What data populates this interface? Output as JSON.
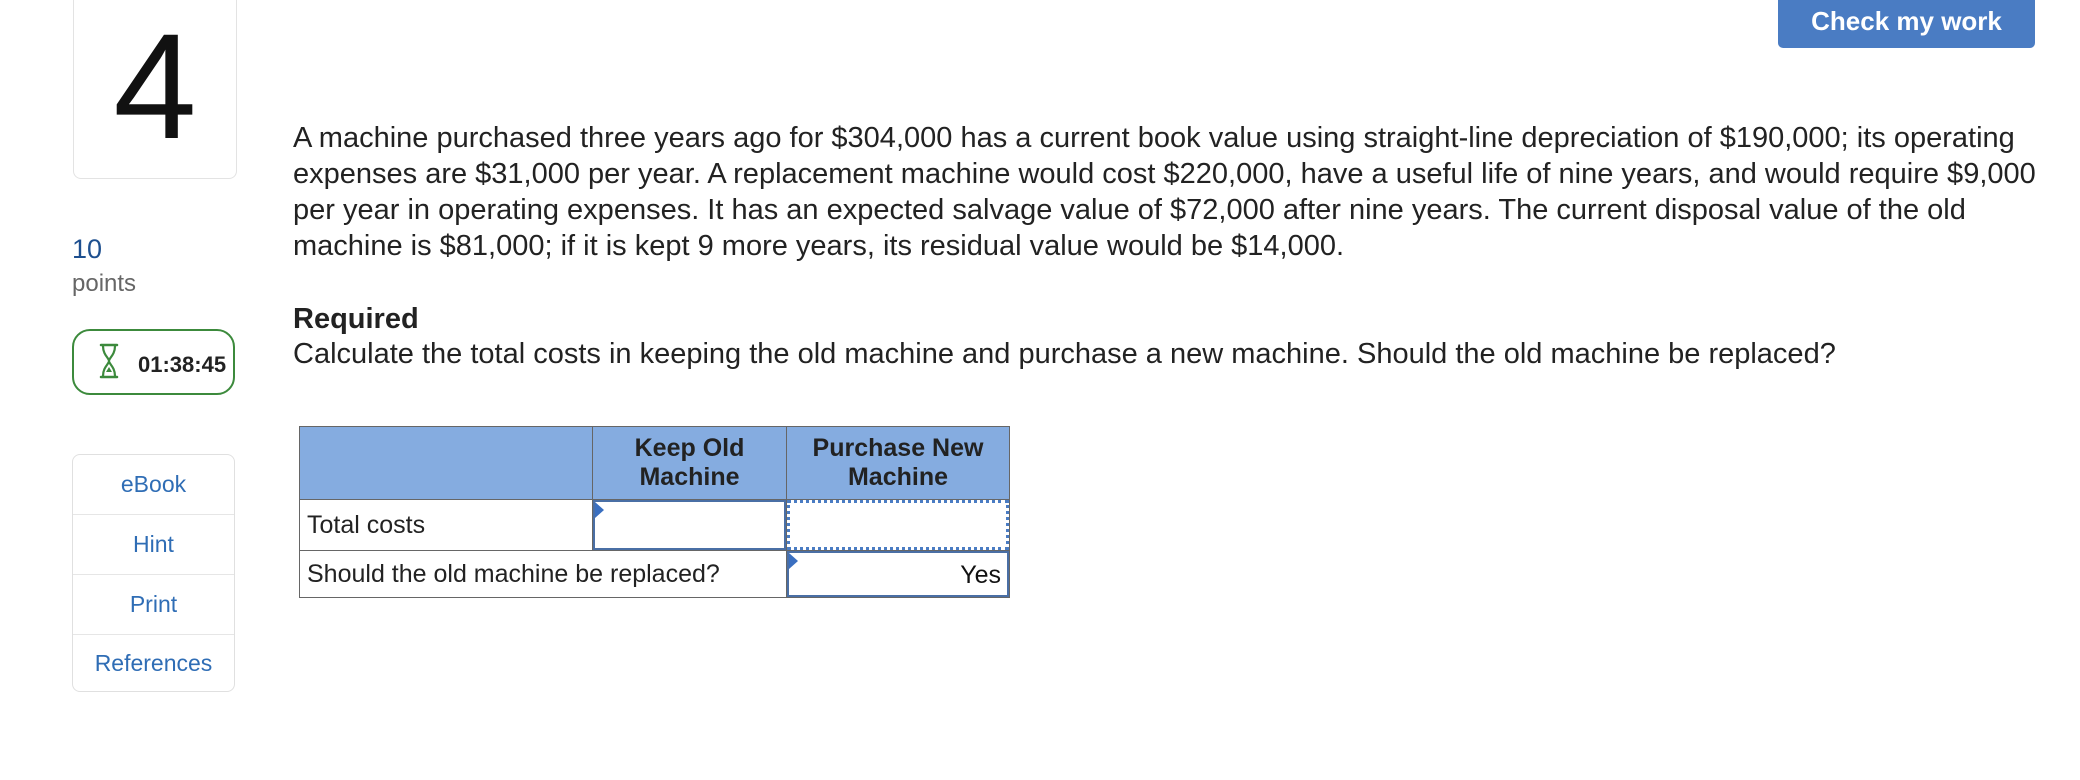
{
  "question": {
    "number": "4",
    "points_value": "10",
    "points_label": "points",
    "timer": "01:38:45"
  },
  "tools": {
    "ebook": "eBook",
    "hint": "Hint",
    "print": "Print",
    "references": "References"
  },
  "header": {
    "check_label": "Check my work"
  },
  "problem": {
    "text": "A machine purchased three years ago for $304,000 has a current book value using straight-line depreciation of $190,000; its operating expenses are $31,000 per year. A replacement machine would cost $220,000, have a useful life of nine years, and would require $9,000 per year in operating expenses. It has an expected salvage value of $72,000 after nine years. The current disposal value of the old machine is $81,000; if it is kept 9 more years, its residual value would be $14,000.",
    "required_title": "Required",
    "required_text": "Calculate the total costs in keeping the old machine and purchase a new machine. Should the old machine be replaced?"
  },
  "table": {
    "columns": [
      "",
      "Keep Old Machine",
      "Purchase New Machine"
    ],
    "rows": [
      {
        "label": "Total costs",
        "keep_old": "",
        "purchase_new": ""
      },
      {
        "label": "Should the old machine be replaced?",
        "answer": "Yes"
      }
    ]
  },
  "colors": {
    "accent": "#4a7cc3",
    "header_fill": "#85ace0",
    "timer_border": "#3c8a3c",
    "link": "#2f6db5"
  },
  "icons": {
    "timer": "hourglass-icon"
  }
}
